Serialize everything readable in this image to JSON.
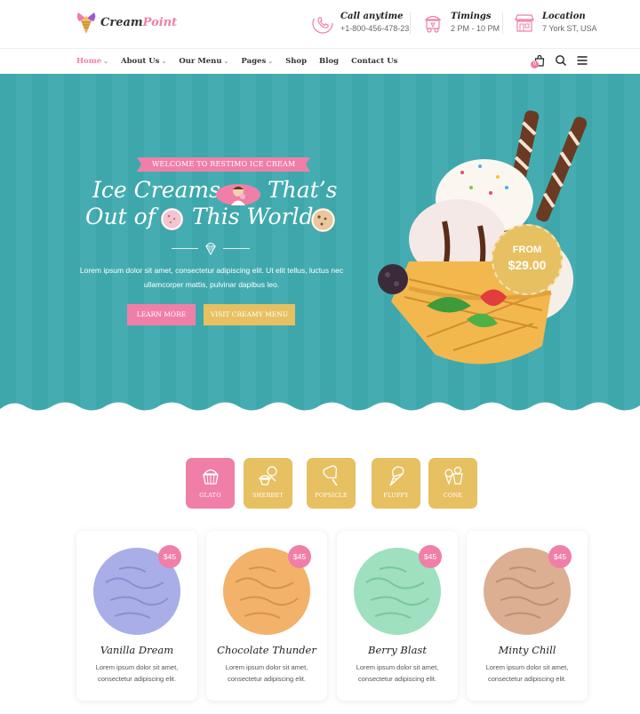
{
  "brand": {
    "name_part1": "Cream",
    "name_part2": "Point"
  },
  "contacts": [
    {
      "title": "Call anytime",
      "value": "+1-800-456-478-23",
      "icon": "phone-icon"
    },
    {
      "title": "Timings",
      "value": "2 PM - 10 PM",
      "icon": "food-cart-icon"
    },
    {
      "title": "Location",
      "value": "7 York ST, USA",
      "icon": "store-icon"
    }
  ],
  "nav": {
    "items": [
      {
        "label": "Home",
        "dropdown": "⌄"
      },
      {
        "label": "About Us",
        "dropdown": "⌄"
      },
      {
        "label": "Our Menu",
        "dropdown": "⌄"
      },
      {
        "label": "Pages",
        "dropdown": "⌄"
      },
      {
        "label": "Shop"
      },
      {
        "label": "Blog"
      },
      {
        "label": "Contact Us"
      }
    ],
    "cart_count": "0"
  },
  "hero": {
    "ribbon": "WELCOME TO RESTIMO ICE CREAM",
    "title_line1_a": "Ice Creams",
    "title_line1_b": "That’s",
    "title_line2_a": "Out of",
    "title_line2_b": "This World",
    "description": "Lorem ipsum dolor sit amet, consectetur adipiscing elit. Ut elit tellus, luctus nec ullamcorper mattis, pulvinar dapibus leo.",
    "button_primary": "LEARN MORE",
    "button_secondary": "VISIT CREAMY MENU",
    "price_from": "FROM",
    "price_value": "$29.00"
  },
  "categories": [
    {
      "label": "GLATO",
      "icon": "gelato-cup-icon"
    },
    {
      "label": "SHERBET",
      "icon": "sherbet-icon"
    },
    {
      "label": "POPSICLE",
      "icon": "popsicle-icon"
    },
    {
      "label": "FLUFFY",
      "icon": "ice-cream-cone-icon"
    },
    {
      "label": "CONE",
      "icon": "cones-icon"
    }
  ],
  "products": [
    {
      "title": "Vanilla Dream",
      "price": "$45",
      "desc": "Lorem ipsum dolor sit amet, consectetur adipiscing elit.",
      "color": "#a9aee8"
    },
    {
      "title": "Chocolate Thunder",
      "price": "$45",
      "desc": "Lorem ipsum dolor sit amet, consectetur adipiscing elit.",
      "color": "#f2b26a"
    },
    {
      "title": "Berry Blast",
      "price": "$45",
      "desc": "Lorem ipsum dolor sit amet, consectetur adipiscing elit.",
      "color": "#9ee0bf"
    },
    {
      "title": "Minty Chill",
      "price": "$45",
      "desc": "Lorem ipsum dolor sit amet, consectetur adipiscing elit.",
      "color": "#dcaf92"
    }
  ],
  "colors": {
    "pink": "#f07fa8",
    "gold": "#e7c062",
    "teal": "#3ea7ab"
  }
}
